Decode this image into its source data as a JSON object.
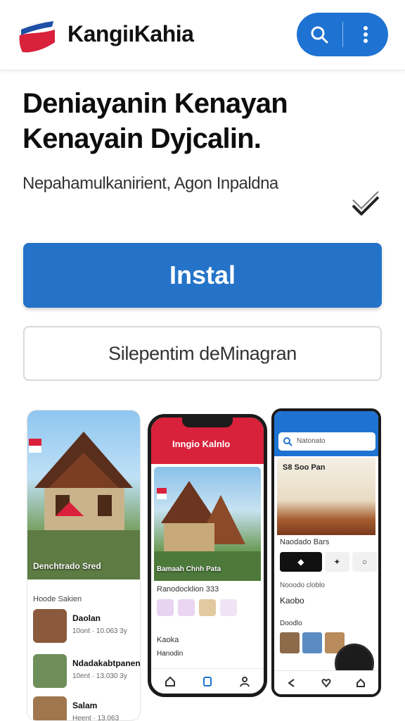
{
  "app": {
    "brand": "KangiıKahia",
    "colors": {
      "accent": "#1e73d2",
      "install": "#2573c8",
      "logo_red": "#d9213b"
    }
  },
  "header": {
    "icons": [
      "logo-icon",
      "search-icon",
      "more-vert-icon"
    ]
  },
  "listing": {
    "title": "Deniayanin Kenayan Kenayain Dyjcalin.",
    "subtitle": "Nepahamulkanirient, Agon Inpaldna",
    "verified_icon": "verified-check-icon"
  },
  "actions": {
    "install_label": "Instal",
    "secondary_label": "Silepentim deMinagran"
  },
  "screenshots": {
    "shot1": {
      "caption": "Denchtrado Sred",
      "section": "Hoode Sakien",
      "items": [
        {
          "name": "Daolan",
          "meta": "10ont · 10.063 3y"
        },
        {
          "name": "Ndadakabtpanen",
          "meta": "10ent · 13.030 3y"
        },
        {
          "name": "Salam",
          "meta": "Heent · 13.063"
        }
      ]
    },
    "shot2": {
      "brand": "Inngio Kalnlo",
      "hero_caption": "Bamaah Chnh Pata",
      "section": "Ranodocklion 333",
      "sub": "Kaoka",
      "row": "Hanodin"
    },
    "shot3": {
      "search_placeholder": "Natonato",
      "hero_title": "S8 Soo Pan",
      "section": "Naodado Bars",
      "sub": "Nooodo cloblo",
      "row": "Kaobo",
      "row2": "Doodlo"
    }
  }
}
